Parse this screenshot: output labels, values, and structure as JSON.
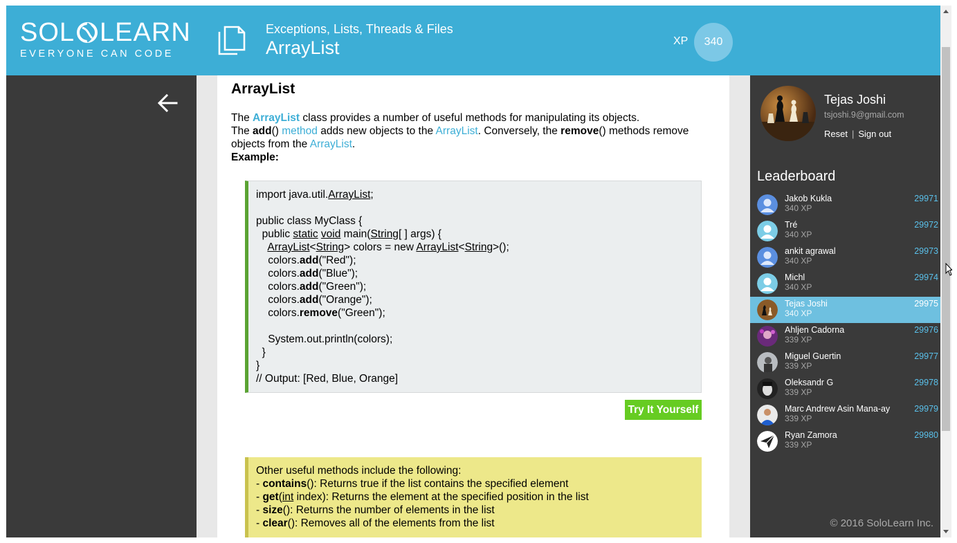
{
  "header": {
    "logo_main_left": "SOL",
    "logo_main_right": "LEARN",
    "logo_sub": "EVERYONE CAN CODE",
    "course_title": "Exceptions, Lists, Threads & Files",
    "lesson_title": "ArrayList",
    "xp_label": "XP",
    "xp_value": "340"
  },
  "lesson": {
    "heading": "ArrayList",
    "para": {
      "l1_a": "The ",
      "l1_kw": "ArrayList",
      "l1_b": " class provides a number of useful methods for manipulating its objects.",
      "l2_a": "The ",
      "l2_add": "add",
      "l2_b": "() ",
      "l2_method": "method",
      "l2_c": " adds new objects to the ",
      "l2_kw": "ArrayList",
      "l2_d": ". Conversely, the ",
      "l2_remove": "remove",
      "l2_e": "() methods remove objects from the ",
      "l2_kw2": "ArrayList",
      "l2_f": ".",
      "example": "Example:"
    },
    "code": {
      "l1": "import java.util.",
      "l1_u": "ArrayList",
      "l1_end": ";",
      "l3": "public class MyClass {",
      "l4_a": "  public ",
      "l4_static": "static",
      "l4_b": " ",
      "l4_void": "void",
      "l4_c": " main(",
      "l4_string": "String",
      "l4_d": "[ ] args) {",
      "l5_a": "    ",
      "l5_al": "ArrayList",
      "l5_lt": "<",
      "l5_s1": "String",
      "l5_b": "> colors = new ",
      "l5_al2": "ArrayList",
      "l5_lt2": "<",
      "l5_s2": "String",
      "l5_c": ">();",
      "adds": [
        {
          "pre": "    colors.",
          "fn": "add",
          "arg": "(\"Red\");"
        },
        {
          "pre": "    colors.",
          "fn": "add",
          "arg": "(\"Blue\");"
        },
        {
          "pre": "    colors.",
          "fn": "add",
          "arg": "(\"Green\");"
        },
        {
          "pre": "    colors.",
          "fn": "add",
          "arg": "(\"Orange\");"
        },
        {
          "pre": "    colors.",
          "fn": "remove",
          "arg": "(\"Green\");"
        }
      ],
      "l12": "    System.out.println(colors);",
      "l13": "  }",
      "l14": "}",
      "l15": "// Output: [Red, Blue, Orange]"
    },
    "try_button": "Try It Yourself",
    "note": {
      "intro": "Other useful methods include the following:",
      "items": [
        {
          "dash": "- ",
          "fn": "contains",
          "pre_u": "(",
          "u": "",
          "rest": "): Returns true if the list contains the specified element"
        },
        {
          "dash": "- ",
          "fn": "get",
          "pre_u": "(",
          "u": "int",
          "rest": " index): Returns the element at the specified position in the list"
        },
        {
          "dash": "- ",
          "fn": "size",
          "pre_u": "(",
          "u": "",
          "rest": "): Returns the number of elements in the list"
        },
        {
          "dash": "- ",
          "fn": "clear",
          "pre_u": "(",
          "u": "",
          "rest": "): Removes all of the elements from the list"
        }
      ]
    }
  },
  "profile": {
    "name": "Tejas Joshi",
    "email": "tsjoshi.9@gmail.com",
    "reset": "Reset",
    "separator": "|",
    "signout": "Sign out"
  },
  "leaderboard": {
    "title": "Leaderboard",
    "rows": [
      {
        "name": "Jakob Kukla",
        "xp": "340 XP",
        "rank": "29971",
        "avatar": "default-blue"
      },
      {
        "name": "Tré",
        "xp": "340 XP",
        "rank": "29972",
        "avatar": "default-light"
      },
      {
        "name": "ankit agrawal",
        "xp": "340 XP",
        "rank": "29973",
        "avatar": "default-blue"
      },
      {
        "name": "Michl",
        "xp": "340 XP",
        "rank": "29974",
        "avatar": "default-light"
      },
      {
        "name": "Tejas Joshi",
        "xp": "340 XP",
        "rank": "29975",
        "avatar": "chess-photo"
      },
      {
        "name": "Ahljen Cadorna",
        "xp": "339 XP",
        "rank": "29976",
        "avatar": "purple-photo"
      },
      {
        "name": "Miguel Guertin",
        "xp": "339 XP",
        "rank": "29977",
        "avatar": "grey-photo"
      },
      {
        "name": "Oleksandr G",
        "xp": "339 XP",
        "rank": "29978",
        "avatar": "bw-face-photo"
      },
      {
        "name": "Marc Andrew Asin Mana-ay",
        "xp": "339 XP",
        "rank": "29979",
        "avatar": "blue-shirt-photo"
      },
      {
        "name": "Ryan Zamora",
        "xp": "339 XP",
        "rank": "29980",
        "avatar": "paper-plane-icon"
      }
    ]
  },
  "footer": {
    "copyright": "© 2016 SoloLearn Inc."
  },
  "colors": {
    "brand": "#3daed6",
    "code_bar": "#5aa332",
    "try_button": "#66cc22",
    "note_bg": "#ede88a",
    "active_row": "#6ec0e0",
    "rank_text": "#5ac0ea"
  }
}
